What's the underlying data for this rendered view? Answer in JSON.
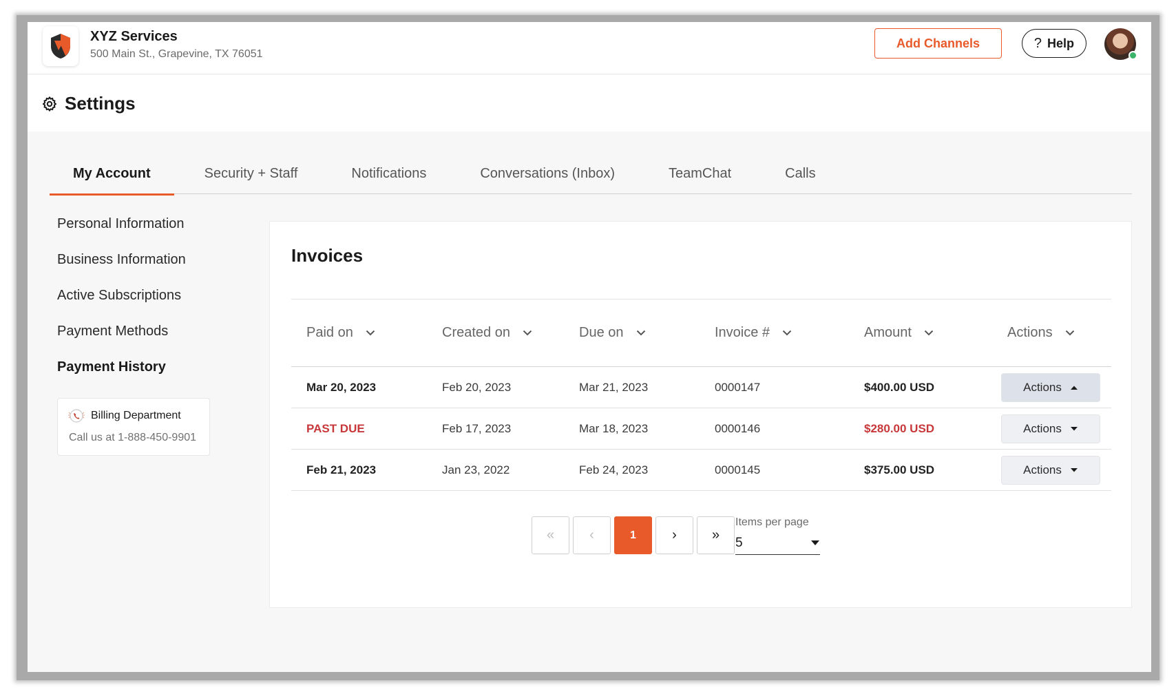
{
  "header": {
    "business_name": "XYZ Services",
    "business_address": "500 Main St., Grapevine, TX 76051",
    "add_channels_label": "Add Channels",
    "help_label": "Help",
    "help_glyph": "?"
  },
  "page": {
    "title": "Settings"
  },
  "tabs": [
    {
      "label": "My Account",
      "active": true
    },
    {
      "label": "Security + Staff"
    },
    {
      "label": "Notifications"
    },
    {
      "label": "Conversations (Inbox)"
    },
    {
      "label": "TeamChat"
    },
    {
      "label": "Calls"
    }
  ],
  "sidenav": {
    "items": [
      {
        "label": "Personal Information"
      },
      {
        "label": "Business Information"
      },
      {
        "label": "Active Subscriptions"
      },
      {
        "label": "Payment Methods"
      },
      {
        "label": "Payment History",
        "active": true
      }
    ],
    "billing": {
      "name": "Billing Department",
      "phone": "Call us at 1-888-450-9901"
    }
  },
  "invoices": {
    "title": "Invoices",
    "columns": [
      "Paid on",
      "Created on",
      "Due on",
      "Invoice #",
      "Amount",
      "Actions"
    ],
    "rows": [
      {
        "paid_on": "Mar 20, 2023",
        "created_on": "Feb 20, 2023",
        "due_on": "Mar 21, 2023",
        "invoice": "0000147",
        "amount": "$400.00 USD",
        "action": "Actions",
        "status": "paid",
        "menu_open": true
      },
      {
        "paid_on": "PAST DUE",
        "created_on": "Feb 17, 2023",
        "due_on": "Mar 18, 2023",
        "invoice": "0000146",
        "amount": "$280.00 USD",
        "action": "Actions",
        "status": "past_due",
        "menu_open": false
      },
      {
        "paid_on": "Feb 21, 2023",
        "created_on": "Jan 23, 2022",
        "due_on": "Feb 24, 2023",
        "invoice": "0000145",
        "amount": "$375.00 USD",
        "action": "Actions",
        "status": "paid",
        "menu_open": false
      }
    ]
  },
  "pagination": {
    "first_glyph": "«",
    "prev_glyph": "‹",
    "current_page": "1",
    "next_glyph": "›",
    "last_glyph": "»",
    "items_per_page_label": "Items per page",
    "items_per_page_value": "5"
  },
  "colors": {
    "accent": "#e85a2a",
    "past_due": "#c8383a",
    "online": "#3bb36b"
  }
}
